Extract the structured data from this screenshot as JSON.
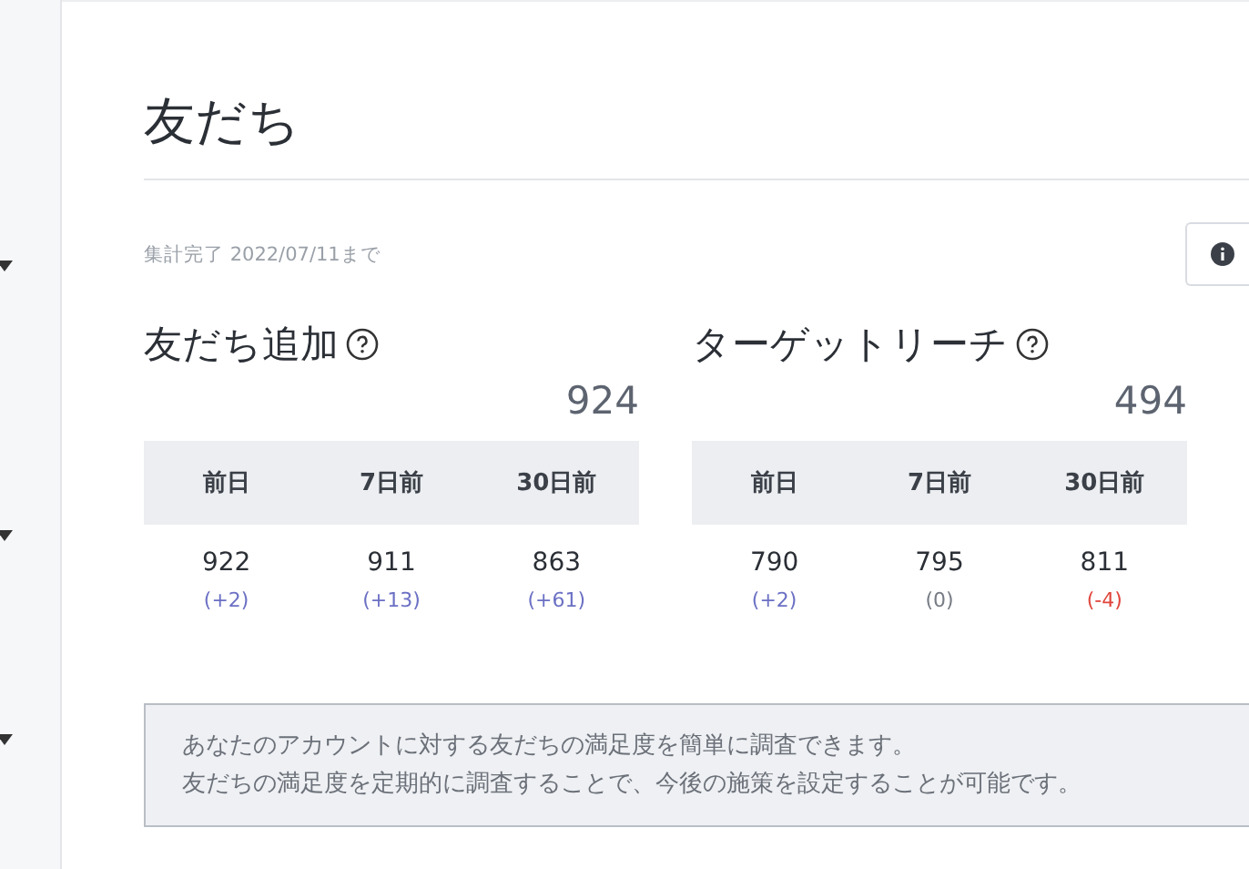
{
  "page": {
    "title": "友だち",
    "period": "集計完了 2022/07/11まで"
  },
  "cards": [
    {
      "title": "友だち追加",
      "total": "924",
      "columns": [
        "前日",
        "7日前",
        "30日前"
      ],
      "cells": [
        {
          "value": "922",
          "delta": "(+2)",
          "kind": "up"
        },
        {
          "value": "911",
          "delta": "(+13)",
          "kind": "up"
        },
        {
          "value": "863",
          "delta": "(+61)",
          "kind": "up"
        }
      ]
    },
    {
      "title": "ターゲットリーチ",
      "total": "494",
      "columns": [
        "前日",
        "7日前",
        "30日前"
      ],
      "cells": [
        {
          "value": "790",
          "delta": "(+2)",
          "kind": "up"
        },
        {
          "value": "795",
          "delta": "(0)",
          "kind": "flat"
        },
        {
          "value": "811",
          "delta": "(-4)",
          "kind": "down"
        }
      ]
    }
  ],
  "notice": [
    "あなたのアカウントに対する友だちの満足度を簡単に調査できます。",
    "友だちの満足度を定期的に調査することで、今後の施策を設定することが可能です。"
  ]
}
